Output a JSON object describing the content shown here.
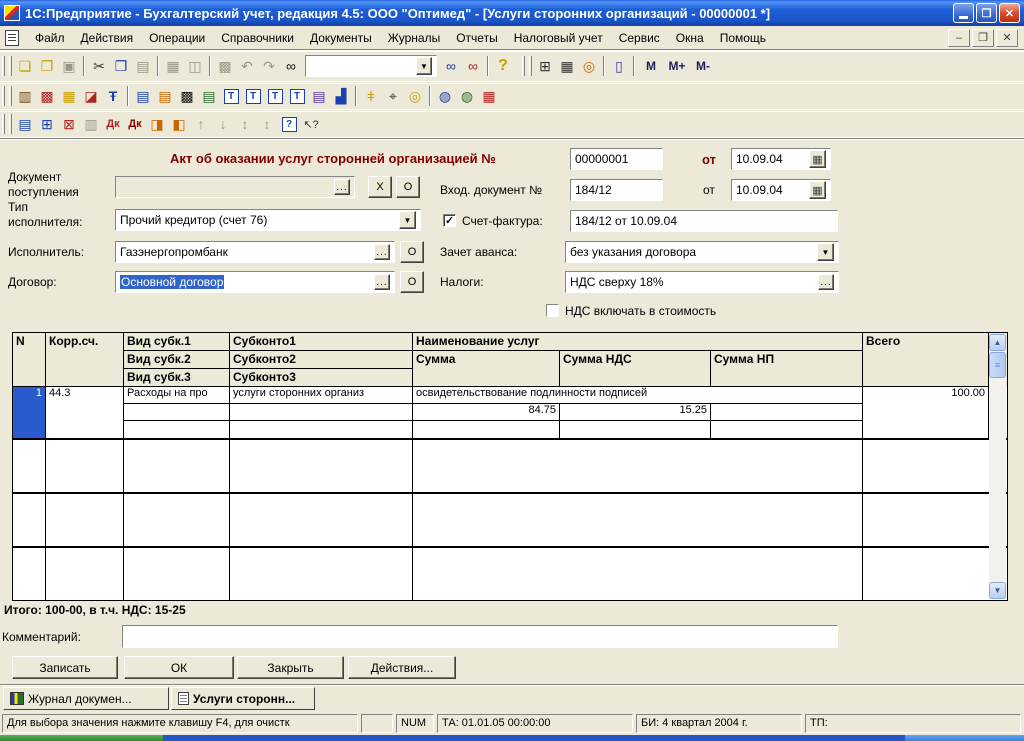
{
  "window_title": "1С:Предприятие - Бухгалтерский учет, редакция 4.5: ООО \"Оптимед\" - [Услуги сторонних организаций - 00000001 *]",
  "title_buttons": {
    "minimize": "",
    "restore": "❐",
    "close": "✕"
  },
  "menu": {
    "items": [
      "Файл",
      "Действия",
      "Операции",
      "Справочники",
      "Документы",
      "Журналы",
      "Отчеты",
      "Налоговый учет",
      "Сервис",
      "Окна",
      "Помощь"
    ]
  },
  "mdi_buttons": {
    "minimize": "–",
    "restore": "❐",
    "close": "✕"
  },
  "toolbar_main": {
    "new": "❏",
    "open": "❒",
    "save": "▣",
    "cut": "✂",
    "copy": "❐",
    "paste": "▤",
    "print": "▦",
    "preview": "◫",
    "props": "▩",
    "undo": "↶",
    "redo": "↷",
    "find": "∞",
    "search_value": "",
    "dropdown_arrow": "▼",
    "find_next": "∞",
    "find_prev": "∞",
    "help": "?",
    "calculator": "⊞",
    "calendar": "▦",
    "table_calc": "◎",
    "book": "▯",
    "m": "M",
    "m_plus": "M+",
    "m_minus": "M-"
  },
  "toolbar_docs": {
    "ledger": "▥",
    "cube": "▩",
    "references": "▦",
    "mark_docs": "◪",
    "t_letter": "Ŧ",
    "list1": "▤",
    "journal2": "▤",
    "chess": "▩",
    "list3": "▤",
    "t_doc1": "Т",
    "t_doc2": "Т",
    "t_doc3": "Т",
    "t_doc4": "Т",
    "report": "▤",
    "chart": "▟",
    "traffic": "ǂ",
    "camera": "⌖",
    "cd": "◎",
    "globe1": "◍",
    "globe2": "◍",
    "calendar26": "▦"
  },
  "toolbar_rows": {
    "insert_row": "▤",
    "add_row": "⊞",
    "delete_row": "⊠",
    "copy_row": "▥",
    "dtkt_off": "Дк",
    "dtkt": "Дк",
    "value_in": "◨",
    "value_out": "◧",
    "move_up": "↑",
    "move_down": "↓",
    "sort_asc": "↕",
    "sort_desc": "↕",
    "help_box": "?",
    "what_is": "↖?"
  },
  "form": {
    "doc_title": "Акт об оказании услуг сторонней организацией №",
    "doc_number": "00000001",
    "ot1": "от",
    "doc_date": "10.09.04",
    "label_incoming": "Вход. документ №",
    "incoming_number": "184/12",
    "ot2": "от",
    "incoming_date": "10.09.04",
    "label_doc_postup1": "Документ",
    "label_doc_postup2": "поступления",
    "doc_postup_value": "",
    "label_tip1": "Тип",
    "label_tip2": "исполнителя:",
    "tip_value": "Прочий кредитор (счет 76)",
    "label_schet_faktura": "Счет-фактура:",
    "schet_faktura_value": "184/12 от 10.09.04",
    "label_ispolnitel": "Исполнитель:",
    "ispolnitel_value": "Газэнергопромбанк",
    "label_zachet": "Зачет аванса:",
    "zachet_value": "без указания договора",
    "label_dogovor": "Договор:",
    "dogovor_value": "Основной договор",
    "label_nalogi": "Налоги:",
    "nalogi_value": "НДС сверху 18%",
    "label_nds_include": "НДС включать в стоимость",
    "ellipsis": "...",
    "clear_x": "X",
    "o_button": "О",
    "check_mark": "✓",
    "dropdown_arrow": "▼",
    "calendar_glyph": "▦"
  },
  "table": {
    "header": {
      "col_n": "N",
      "col_korr": "Корр.сч.",
      "vid1": "Вид субк.1",
      "vid2": "Вид субк.2",
      "vid3": "Вид субк.3",
      "sub1": "Субконто1",
      "sub2": "Субконто2",
      "sub3": "Субконто3",
      "name": "Наименование услуг",
      "summa": "Сумма",
      "summa_nds": "Сумма НДС",
      "summa_np": "Сумма НП",
      "total": "Всего"
    },
    "rows": [
      {
        "n": "1",
        "korr": "44.3",
        "vid1": "Расходы на про",
        "sub1": "услуги сторонних организ",
        "name": "освидетельствование подлинности подписей",
        "summa": "84.75",
        "nds": "15.25",
        "np": "",
        "total": "100.00"
      }
    ],
    "scrollbar": {
      "up": "▲",
      "down": "▼",
      "thumb": "≡"
    }
  },
  "footer": {
    "totals": "Итого: 100-00, в т.ч. НДС: 15-25",
    "comment_label": "Комментарий:",
    "comment_value": "",
    "buttons": {
      "save": "Записать",
      "ok": "ОК",
      "close": "Закрыть",
      "actions": "Действия..."
    }
  },
  "tabs": {
    "journal": "Журнал докумен...",
    "current": "Услуги сторонн..."
  },
  "status_bar": {
    "message": "Для выбора значения нажмите клавишу F4, для очистк",
    "num": "NUM",
    "ta": "ТА: 01.01.05  00:00:00",
    "bi": "БИ: 4 квартал 2004 г.",
    "tp": "ТП:"
  }
}
